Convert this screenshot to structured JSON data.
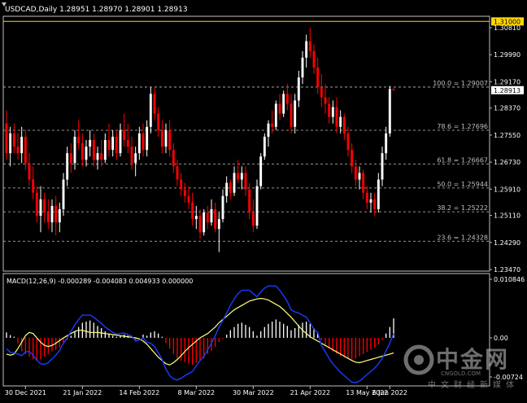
{
  "header": {
    "symbol": "USDCAD,Daily",
    "ohlc": "1.28951 1.28970 1.28901 1.28913"
  },
  "macd_header": "MACD(12,26,9) -0.000289 -0.004083 0.004933 0.000000",
  "watermark": {
    "main": "中金网",
    "url": "CNGOLD.COM",
    "sub": "中文财经新媒体"
  },
  "colors": {
    "background": "#000000",
    "bull": "#ffffff",
    "bear": "#ff0000",
    "macd_positive": "#ffffff",
    "macd_negative": "#ff0000",
    "signal_line": "#ffff80",
    "macd_line": "#1a3cff",
    "resistance_line": "#ffd700",
    "price_label_bg": "#ffffff",
    "resistance_label_bg": "#ffd700"
  },
  "chart_data": [
    {
      "type": "candlestick",
      "title": "USDCAD,Daily",
      "y_range": [
        1.2347,
        1.3081
      ],
      "y_ticks": [
        "1.30810",
        "1.29990",
        "1.29170",
        "1.28370",
        "1.27550",
        "1.26730",
        "1.25910",
        "1.25110",
        "1.24290",
        "1.23470"
      ],
      "x_ticks": [
        "30 Dec 2021",
        "21 Jan 2022",
        "14 Feb 2022",
        "8 Mar 2022",
        "30 Mar 2022",
        "21 Apr 2022",
        "13 May 2022",
        "6 Jun 2022"
      ],
      "last_price": "1.28913",
      "resistance": {
        "value": 1.31,
        "label": "1.31000"
      },
      "fibonacci": [
        {
          "value": 1.29007,
          "label": "100.0 = 1.29007"
        },
        {
          "value": 1.27696,
          "label": "78.6 = 1.27696"
        },
        {
          "value": 1.26667,
          "label": "61.8 = 1.26667"
        },
        {
          "value": 1.25944,
          "label": "50.0 = 1.25944"
        },
        {
          "value": 1.25222,
          "label": "38.2 = 1.25222"
        },
        {
          "value": 1.24328,
          "label": "23.6 = 1.24328"
        }
      ],
      "candles": [
        [
          1.279,
          1.283,
          1.268,
          1.27
        ],
        [
          1.27,
          1.278,
          1.266,
          1.276
        ],
        [
          1.276,
          1.279,
          1.27,
          1.272
        ],
        [
          1.272,
          1.276,
          1.268,
          1.27
        ],
        [
          1.27,
          1.278,
          1.267,
          1.275
        ],
        [
          1.275,
          1.277,
          1.265,
          1.267
        ],
        [
          1.267,
          1.27,
          1.26,
          1.262
        ],
        [
          1.262,
          1.266,
          1.256,
          1.258
        ],
        [
          1.258,
          1.26,
          1.249,
          1.251
        ],
        [
          1.251,
          1.26,
          1.246,
          1.256
        ],
        [
          1.256,
          1.258,
          1.249,
          1.252
        ],
        [
          1.252,
          1.256,
          1.247,
          1.249
        ],
        [
          1.249,
          1.256,
          1.246,
          1.254
        ],
        [
          1.254,
          1.257,
          1.245,
          1.249
        ],
        [
          1.249,
          1.255,
          1.246,
          1.253
        ],
        [
          1.253,
          1.264,
          1.251,
          1.262
        ],
        [
          1.262,
          1.272,
          1.26,
          1.27
        ],
        [
          1.27,
          1.273,
          1.264,
          1.267
        ],
        [
          1.267,
          1.277,
          1.265,
          1.275
        ],
        [
          1.275,
          1.28,
          1.271,
          1.273
        ],
        [
          1.273,
          1.276,
          1.266,
          1.268
        ],
        [
          1.268,
          1.274,
          1.266,
          1.272
        ],
        [
          1.272,
          1.277,
          1.269,
          1.274
        ],
        [
          1.274,
          1.276,
          1.266,
          1.268
        ],
        [
          1.268,
          1.272,
          1.265,
          1.27
        ],
        [
          1.27,
          1.274,
          1.266,
          1.268
        ],
        [
          1.268,
          1.276,
          1.267,
          1.274
        ],
        [
          1.274,
          1.279,
          1.269,
          1.271
        ],
        [
          1.271,
          1.277,
          1.269,
          1.275
        ],
        [
          1.275,
          1.277,
          1.268,
          1.27
        ],
        [
          1.27,
          1.279,
          1.269,
          1.277
        ],
        [
          1.277,
          1.282,
          1.272,
          1.274
        ],
        [
          1.274,
          1.279,
          1.27,
          1.272
        ],
        [
          1.272,
          1.275,
          1.265,
          1.267
        ],
        [
          1.267,
          1.272,
          1.263,
          1.27
        ],
        [
          1.27,
          1.278,
          1.268,
          1.276
        ],
        [
          1.276,
          1.279,
          1.269,
          1.271
        ],
        [
          1.271,
          1.28,
          1.269,
          1.278
        ],
        [
          1.278,
          1.29,
          1.276,
          1.288
        ],
        [
          1.288,
          1.29,
          1.28,
          1.282
        ],
        [
          1.282,
          1.284,
          1.275,
          1.277
        ],
        [
          1.277,
          1.28,
          1.27,
          1.272
        ],
        [
          1.272,
          1.279,
          1.27,
          1.277
        ],
        [
          1.277,
          1.28,
          1.269,
          1.271
        ],
        [
          1.271,
          1.273,
          1.264,
          1.266
        ],
        [
          1.266,
          1.268,
          1.26,
          1.262
        ],
        [
          1.262,
          1.264,
          1.257,
          1.259
        ],
        [
          1.259,
          1.261,
          1.255,
          1.257
        ],
        [
          1.257,
          1.26,
          1.253,
          1.255
        ],
        [
          1.255,
          1.258,
          1.248,
          1.25
        ],
        [
          1.25,
          1.254,
          1.247,
          1.251
        ],
        [
          1.251,
          1.253,
          1.244,
          1.246
        ],
        [
          1.246,
          1.253,
          1.245,
          1.252
        ],
        [
          1.252,
          1.254,
          1.247,
          1.249
        ],
        [
          1.249,
          1.256,
          1.248,
          1.253
        ],
        [
          1.253,
          1.255,
          1.246,
          1.247
        ],
        [
          1.247,
          1.252,
          1.24,
          1.25
        ],
        [
          1.25,
          1.259,
          1.249,
          1.257
        ],
        [
          1.257,
          1.263,
          1.255,
          1.261
        ],
        [
          1.261,
          1.262,
          1.256,
          1.258
        ],
        [
          1.258,
          1.266,
          1.257,
          1.264
        ],
        [
          1.264,
          1.268,
          1.261,
          1.262
        ],
        [
          1.262,
          1.266,
          1.259,
          1.264
        ],
        [
          1.264,
          1.266,
          1.257,
          1.259
        ],
        [
          1.259,
          1.261,
          1.25,
          1.252
        ],
        [
          1.252,
          1.256,
          1.246,
          1.248
        ],
        [
          1.248,
          1.262,
          1.247,
          1.26
        ],
        [
          1.26,
          1.27,
          1.259,
          1.269
        ],
        [
          1.269,
          1.276,
          1.268,
          1.275
        ],
        [
          1.275,
          1.28,
          1.272,
          1.279
        ],
        [
          1.279,
          1.283,
          1.276,
          1.278
        ],
        [
          1.278,
          1.286,
          1.277,
          1.285
        ],
        [
          1.285,
          1.288,
          1.28,
          1.282
        ],
        [
          1.282,
          1.289,
          1.281,
          1.288
        ],
        [
          1.288,
          1.291,
          1.283,
          1.285
        ],
        [
          1.285,
          1.288,
          1.276,
          1.278
        ],
        [
          1.278,
          1.288,
          1.276,
          1.286
        ],
        [
          1.286,
          1.295,
          1.284,
          1.293
        ],
        [
          1.293,
          1.301,
          1.291,
          1.299
        ],
        [
          1.299,
          1.306,
          1.296,
          1.304
        ],
        [
          1.304,
          1.3081,
          1.299,
          1.301
        ],
        [
          1.301,
          1.303,
          1.294,
          1.296
        ],
        [
          1.296,
          1.299,
          1.288,
          1.29
        ],
        [
          1.29,
          1.294,
          1.284,
          1.287
        ],
        [
          1.287,
          1.291,
          1.282,
          1.285
        ],
        [
          1.285,
          1.287,
          1.279,
          1.281
        ],
        [
          1.281,
          1.286,
          1.279,
          1.284
        ],
        [
          1.284,
          1.287,
          1.276,
          1.278
        ],
        [
          1.278,
          1.283,
          1.276,
          1.281
        ],
        [
          1.281,
          1.282,
          1.274,
          1.276
        ],
        [
          1.276,
          1.278,
          1.269,
          1.271
        ],
        [
          1.271,
          1.273,
          1.264,
          1.266
        ],
        [
          1.266,
          1.268,
          1.26,
          1.262
        ],
        [
          1.262,
          1.266,
          1.259,
          1.264
        ],
        [
          1.264,
          1.265,
          1.256,
          1.258
        ],
        [
          1.258,
          1.26,
          1.253,
          1.255
        ],
        [
          1.255,
          1.258,
          1.252,
          1.256
        ],
        [
          1.256,
          1.258,
          1.251,
          1.253
        ],
        [
          1.253,
          1.264,
          1.252,
          1.262
        ],
        [
          1.262,
          1.272,
          1.26,
          1.27
        ],
        [
          1.27,
          1.278,
          1.268,
          1.276
        ],
        [
          1.276,
          1.2904,
          1.275,
          1.2895
        ],
        [
          1.2895,
          1.2897,
          1.289,
          1.2891
        ]
      ]
    },
    {
      "type": "histogram_with_lines",
      "title": "MACD(12,26,9)",
      "y_range": [
        -0.00724,
        0.010846
      ],
      "y_ticks": [
        "0.010846",
        "0.00",
        "-0.00724"
      ],
      "histogram": [
        0.001,
        0.0005,
        0.0002,
        -0.001,
        -0.0025,
        -0.003,
        -0.0035,
        -0.004,
        -0.0042,
        -0.004,
        -0.0035,
        -0.003,
        -0.0025,
        -0.0022,
        -0.0018,
        -0.001,
        -0.0004,
        0.0004,
        0.0012,
        0.002,
        0.0028,
        0.003,
        0.0032,
        0.0028,
        0.0022,
        0.0018,
        0.0012,
        0.0008,
        0.0004,
        0.0002,
        0.0004,
        0.0006,
        0.0004,
        0.0002,
        -0.0006,
        -0.0002,
        0.0006,
        0.0004,
        0.001,
        0.0012,
        0.0008,
        0.0002,
        -0.001,
        -0.002,
        -0.003,
        -0.0038,
        -0.0042,
        -0.0045,
        -0.0048,
        -0.005,
        -0.0046,
        -0.0042,
        -0.0038,
        -0.003,
        -0.0024,
        -0.0016,
        -0.0008,
        -0.0002,
        0.0006,
        0.0014,
        0.002,
        0.0026,
        0.0028,
        0.0024,
        0.002,
        0.0012,
        0.0004,
        0.0012,
        0.002,
        0.0026,
        0.003,
        0.0034,
        0.003,
        0.0026,
        0.0022,
        0.0014,
        0.0018,
        0.0024,
        0.0028,
        0.003,
        0.0026,
        0.0018,
        0.0008,
        -0.0004,
        -0.0012,
        -0.002,
        -0.0026,
        -0.003,
        -0.0034,
        -0.0036,
        -0.0038,
        -0.004,
        -0.0038,
        -0.0034,
        -0.003,
        -0.0026,
        -0.0022,
        -0.0018,
        -0.0012,
        -0.0004,
        0.0008,
        0.002,
        0.0036
      ],
      "signal_line": [
        -0.003,
        -0.0032,
        -0.003,
        -0.002,
        -0.0008,
        0.0004,
        0.001,
        0.0008,
        0.0,
        -0.0008,
        -0.0014,
        -0.0016,
        -0.0014,
        -0.001,
        -0.0005,
        0.0,
        0.0004,
        0.0008,
        0.0012,
        0.0014,
        0.0014,
        0.0012,
        0.001,
        0.001,
        0.001,
        0.0009,
        0.0008,
        0.0007,
        0.0006,
        0.0005,
        0.0004,
        0.0003,
        0.0002,
        0.0001,
        0.0,
        -0.0002,
        -0.0006,
        -0.0012,
        -0.002,
        -0.0028,
        -0.0036,
        -0.0042,
        -0.0048,
        -0.005,
        -0.0046,
        -0.004,
        -0.0033,
        -0.0025,
        -0.0018,
        -0.0012,
        -0.0006,
        0.0,
        0.0004,
        0.0008,
        0.0014,
        0.002,
        0.0028,
        0.0034,
        0.004,
        0.0046,
        0.0052,
        0.0056,
        0.006,
        0.0064,
        0.0068,
        0.007,
        0.0072,
        0.0073,
        0.0072,
        0.007,
        0.0066,
        0.0062,
        0.0058,
        0.0052,
        0.0045,
        0.0038,
        0.003,
        0.0022,
        0.0014,
        0.0008,
        0.0002,
        -0.0002,
        -0.0006,
        -0.001,
        -0.0014,
        -0.0018,
        -0.0022,
        -0.0026,
        -0.003,
        -0.0034,
        -0.0038,
        -0.0042,
        -0.0045,
        -0.0046,
        -0.0044,
        -0.0042,
        -0.004,
        -0.0038,
        -0.0036,
        -0.0034,
        -0.0032,
        -0.003,
        -0.0028
      ],
      "macd_line": [
        -0.002,
        -0.0027,
        -0.0028,
        -0.003,
        -0.0033,
        -0.0026,
        -0.0025,
        -0.0032,
        -0.0042,
        -0.0048,
        -0.0049,
        -0.0046,
        -0.0039,
        -0.0032,
        -0.0023,
        -0.001,
        0.0,
        0.0012,
        0.0024,
        0.0034,
        0.0042,
        0.0042,
        0.0042,
        0.0038,
        0.0032,
        0.0027,
        0.002,
        0.0015,
        0.001,
        0.0007,
        0.0008,
        0.0009,
        0.0006,
        0.0003,
        -0.0006,
        -0.0004,
        0.0,
        -0.0008,
        -0.001,
        -0.0016,
        -0.0028,
        -0.004,
        -0.0058,
        -0.007,
        -0.0076,
        -0.0078,
        -0.0075,
        -0.007,
        -0.0066,
        -0.0062,
        -0.0052,
        -0.0042,
        -0.0034,
        -0.0022,
        -0.001,
        0.0004,
        0.002,
        0.0032,
        0.0046,
        0.006,
        0.0072,
        0.0082,
        0.0088,
        0.0088,
        0.0088,
        0.0082,
        0.0076,
        0.0085,
        0.0092,
        0.0096,
        0.0096,
        0.0096,
        0.0088,
        0.0078,
        0.0067,
        0.0052,
        0.0048,
        0.0046,
        0.0042,
        0.0038,
        0.0028,
        0.0016,
        0.001,
        -0.0014,
        -0.0026,
        -0.0038,
        -0.0048,
        -0.0056,
        -0.0064,
        -0.007,
        -0.0076,
        -0.0082,
        -0.0083,
        -0.008,
        -0.0074,
        -0.0068,
        -0.0062,
        -0.0056,
        -0.0048,
        -0.0038,
        -0.0024,
        -0.001,
        0.0008
      ]
    }
  ]
}
